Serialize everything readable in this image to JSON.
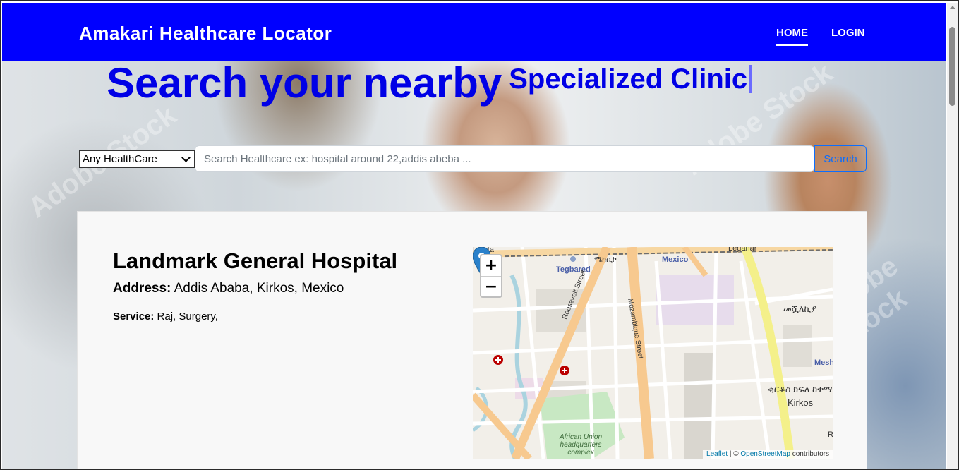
{
  "navbar": {
    "brand": "Amakari Healthcare Locator",
    "links": [
      {
        "label": "HOME",
        "active": true
      },
      {
        "label": "LOGIN",
        "active": false
      }
    ],
    "background_color": "#0000ff"
  },
  "hero": {
    "headline_main": "Search your nearby",
    "headline_typed": "Specialized Clinic",
    "headline_color": "#0000e6",
    "watermark": "Adobe Stock"
  },
  "search": {
    "category_selected": "Any HealthCare",
    "placeholder": "Search Healthcare ex: hospital around 22,addis abeba ...",
    "button_label": "Search"
  },
  "result": {
    "name": "Landmark General Hospital",
    "address_label": "Address:",
    "address_value": "Addis Ababa, Kirkos, Mexico",
    "service_label": "Service:",
    "service_value": "Raj, Surgery,"
  },
  "map": {
    "zoom_in": "+",
    "zoom_out": "−",
    "attribution_leaflet": "Leaflet",
    "attribution_sep": " | © ",
    "attribution_osm": "OpenStreetMap",
    "attribution_tail": " contributors",
    "labels": {
      "lideta": "Lideta",
      "tegbared": "Tegbared",
      "mexico": "Mexico",
      "mexico_amharic": "ሜክሲኮ",
      "leganar": "Leganar",
      "roosevelt": "Roosevelt Street",
      "mozambique": "Mozambique Street",
      "meshualekia": "መሿለኪያ",
      "mesh": "Mesh",
      "kirkos_amharic": "ቂርቆስ ክፍለ ከተማ",
      "kirkos": "Kirkos",
      "african_union": "African Union headquarters complex",
      "r": "R"
    },
    "marker_icon": "map-pin-icon",
    "hospital_icon": "hospital-cross-icon"
  }
}
